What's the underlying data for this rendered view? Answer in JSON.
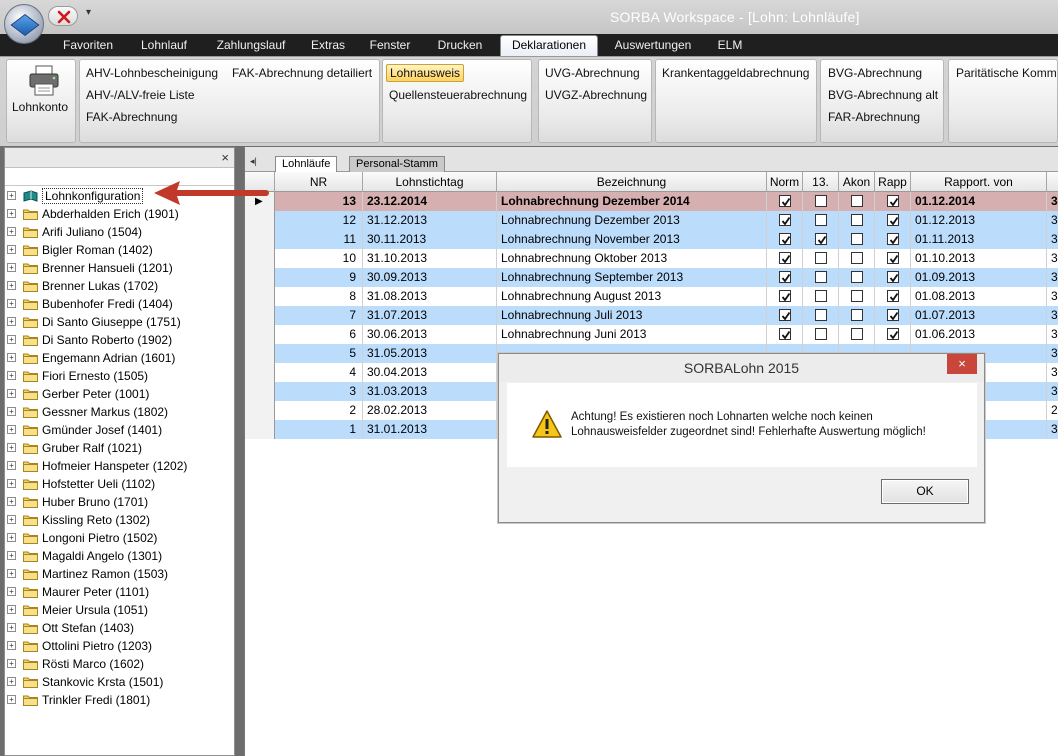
{
  "window": {
    "title": "SORBA Workspace - [Lohn: Lohnläufe]",
    "quick_access_menu": "▾"
  },
  "ribbon_tabs": [
    "Favoriten",
    "Lohnlauf",
    "Zahlungslauf",
    "Extras",
    "Fenster",
    "Drucken",
    "Deklarationen",
    "Auswertungen",
    "ELM"
  ],
  "active_tab": "Deklarationen",
  "ribbon": {
    "lohnkonto": "Lohnkonto",
    "ahv_lohnbescheinigung": "AHV-Lohnbescheinigung",
    "ahv_alv_freie_liste": "AHV-/ALV-freie Liste",
    "fak_abrechnung": "FAK-Abrechnung",
    "fak_abrechnung_detailiert": "FAK-Abrechnung detailiert",
    "lohnausweis": "Lohnausweis",
    "quellensteuerabrechnung": "Quellensteuerabrechnung",
    "uvg_abrechnung": "UVG-Abrechnung",
    "uvgz_abrechnung": "UVGZ-Abrechnung",
    "krankentaggeldabrechnung": "Krankentaggeldabrechnung",
    "bvg_abrechnung": "BVG-Abrechnung",
    "bvg_abrechnung_alt": "BVG-Abrechnung alt",
    "far_abrechnung": "FAR-Abrechnung",
    "paritaetische_kommission": "Paritätische Kommis"
  },
  "left_pane": {
    "close_glyph": "×",
    "tree": [
      "Lohnkonfiguration",
      "Abderhalden Erich (1901)",
      "Arifi Juliano (1504)",
      "Bigler Roman (1402)",
      "Brenner Hansueli (1201)",
      "Brenner Lukas (1702)",
      "Bubenhofer Fredi (1404)",
      "Di Santo Giuseppe (1751)",
      "Di Santo Roberto (1902)",
      "Engemann Adrian (1601)",
      "Fiori Ernesto (1505)",
      "Gerber Peter (1001)",
      "Gessner Markus (1802)",
      "Gmünder Josef (1401)",
      "Gruber Ralf (1021)",
      "Hofmeier Hanspeter (1202)",
      "Hofstetter Ueli (1102)",
      "Huber Bruno (1701)",
      "Kissling Reto (1302)",
      "Longoni Pietro (1502)",
      "Magaldi Angelo (1301)",
      "Martinez Ramon (1503)",
      "Maurer Peter (1101)",
      "Meier Ursula (1051)",
      "Ott Stefan (1403)",
      "Ottolini Pietro (1203)",
      "Rösti Marco (1602)",
      "Stankovic Krsta (1501)",
      "Trinkler Fredi (1801)"
    ]
  },
  "grid_tabs": [
    "Lohnläufe",
    "Personal-Stamm"
  ],
  "grid": {
    "columns": [
      "NR",
      "Lohnstichtag",
      "Bezeichnung",
      "Norm",
      "13.",
      "Akon",
      "Rapp",
      "Rapport. von"
    ],
    "rows": [
      {
        "nr": "13",
        "stichtag": "23.12.2014",
        "bez": "Lohnabrechnung Dezember 2014",
        "norm": true,
        "m13": false,
        "akon": false,
        "rapp": true,
        "von": "01.12.2014",
        "last": "3",
        "style": "current"
      },
      {
        "nr": "12",
        "stichtag": "31.12.2013",
        "bez": "Lohnabrechnung Dezember 2013",
        "norm": true,
        "m13": false,
        "akon": false,
        "rapp": true,
        "von": "01.12.2013",
        "last": "3",
        "style": "blue"
      },
      {
        "nr": "11",
        "stichtag": "30.11.2013",
        "bez": "Lohnabrechnung November 2013",
        "norm": true,
        "m13": true,
        "akon": false,
        "rapp": true,
        "von": "01.11.2013",
        "last": "3",
        "style": "blue"
      },
      {
        "nr": "10",
        "stichtag": "31.10.2013",
        "bez": "Lohnabrechnung Oktober 2013",
        "norm": true,
        "m13": false,
        "akon": false,
        "rapp": true,
        "von": "01.10.2013",
        "last": "3",
        "style": "white"
      },
      {
        "nr": "9",
        "stichtag": "30.09.2013",
        "bez": "Lohnabrechnung September 2013",
        "norm": true,
        "m13": false,
        "akon": false,
        "rapp": true,
        "von": "01.09.2013",
        "last": "3",
        "style": "blue"
      },
      {
        "nr": "8",
        "stichtag": "31.08.2013",
        "bez": "Lohnabrechnung August 2013",
        "norm": true,
        "m13": false,
        "akon": false,
        "rapp": true,
        "von": "01.08.2013",
        "last": "3",
        "style": "white"
      },
      {
        "nr": "7",
        "stichtag": "31.07.2013",
        "bez": "Lohnabrechnung Juli 2013",
        "norm": true,
        "m13": false,
        "akon": false,
        "rapp": true,
        "von": "01.07.2013",
        "last": "3",
        "style": "blue"
      },
      {
        "nr": "6",
        "stichtag": "30.06.2013",
        "bez": "Lohnabrechnung Juni 2013",
        "norm": true,
        "m13": false,
        "akon": false,
        "rapp": true,
        "von": "01.06.2013",
        "last": "3",
        "style": "white"
      },
      {
        "nr": "5",
        "stichtag": "31.05.2013",
        "bez": "",
        "norm": null,
        "m13": null,
        "akon": null,
        "rapp": null,
        "von": "",
        "last": "3",
        "style": "blue"
      },
      {
        "nr": "4",
        "stichtag": "30.04.2013",
        "bez": "",
        "norm": null,
        "m13": null,
        "akon": null,
        "rapp": null,
        "von": "",
        "last": "3",
        "style": "white"
      },
      {
        "nr": "3",
        "stichtag": "31.03.2013",
        "bez": "",
        "norm": null,
        "m13": null,
        "akon": null,
        "rapp": null,
        "von": "",
        "last": "3",
        "style": "blue"
      },
      {
        "nr": "2",
        "stichtag": "28.02.2013",
        "bez": "",
        "norm": null,
        "m13": null,
        "akon": null,
        "rapp": null,
        "von": "",
        "last": "2",
        "style": "white"
      },
      {
        "nr": "1",
        "stichtag": "31.01.2013",
        "bez": "",
        "norm": null,
        "m13": null,
        "akon": null,
        "rapp": null,
        "von": "",
        "last": "3",
        "style": "blue"
      }
    ]
  },
  "dialog": {
    "title": "SORBALohn  2015",
    "close_glyph": "×",
    "message_line1": "Achtung! Es existieren noch Lohnarten welche noch keinen",
    "message_line2": "Lohnausweisfelder zugeordnet sind! Fehlerhafte Auswertung möglich!",
    "ok_label": "OK"
  },
  "colors": {
    "row_blue": "#bcdcfc",
    "row_current": "#d6b0b0",
    "arrow": "#c0392b",
    "highlight": "#ffd35c"
  }
}
